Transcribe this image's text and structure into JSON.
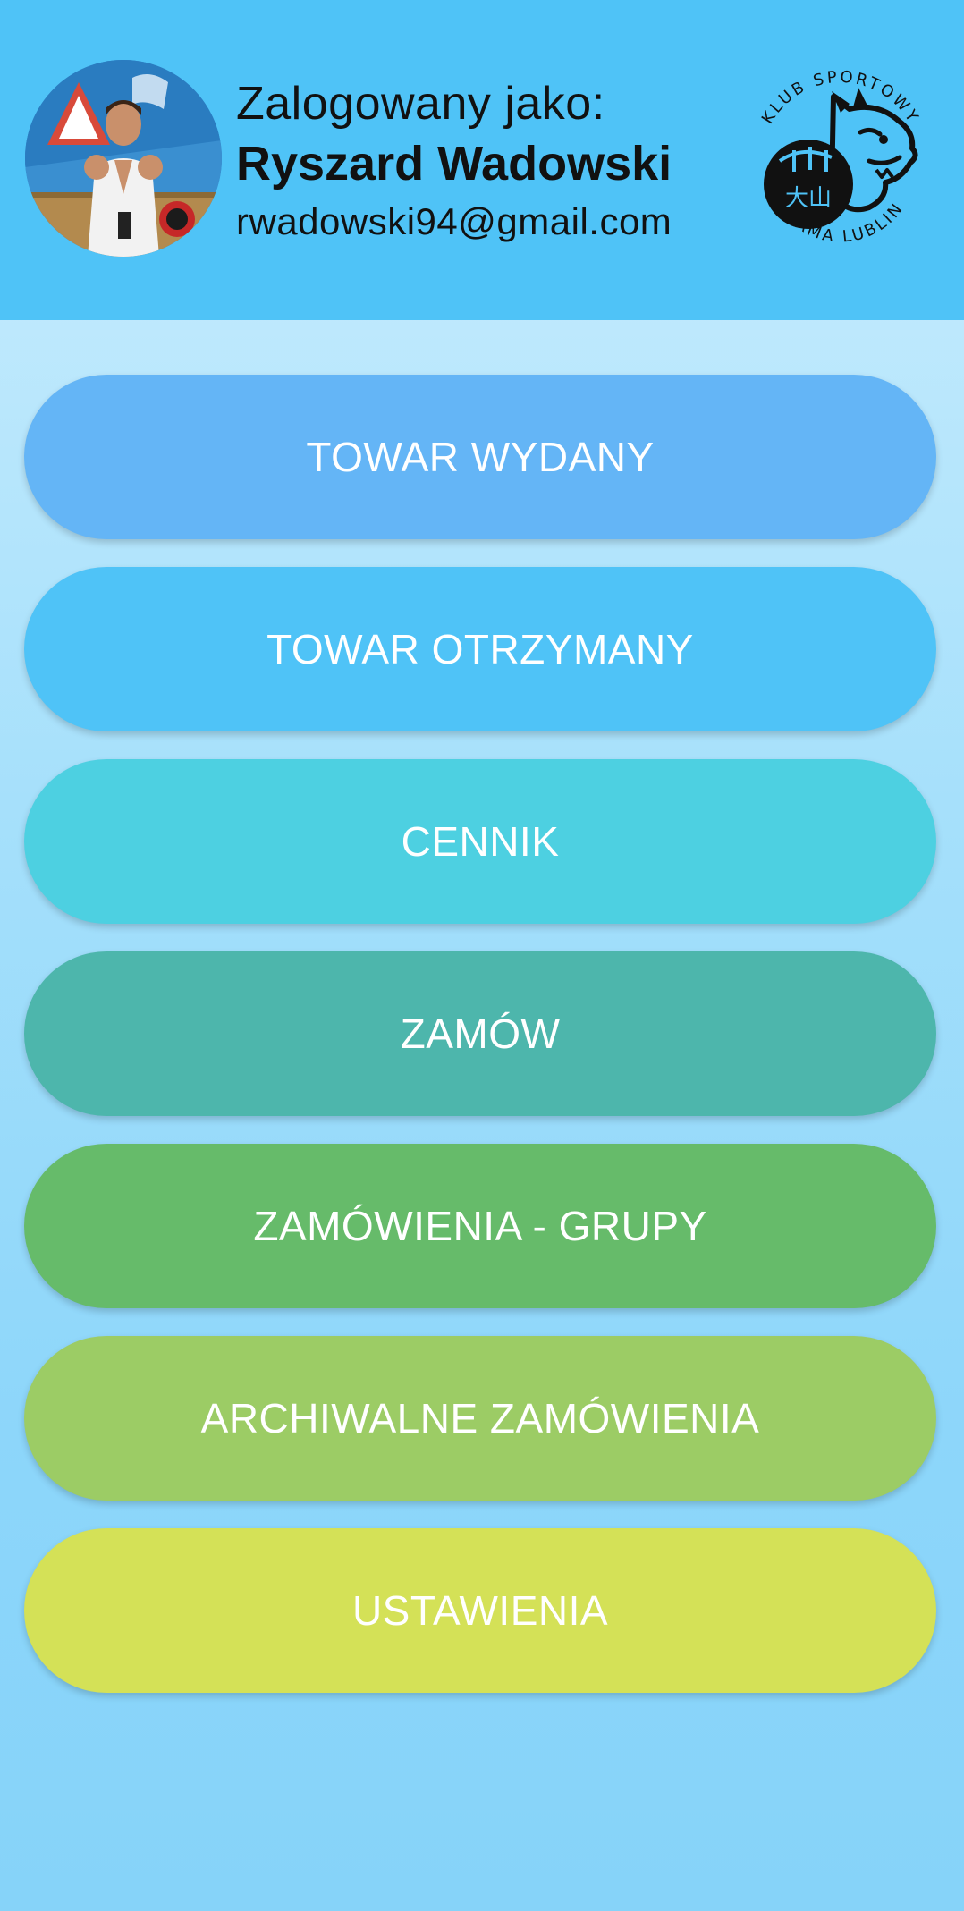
{
  "header": {
    "logged_as_label": "Zalogowany jako:",
    "user_name": "Ryszard Wadowski",
    "user_email": "rwadowski94@gmail.com",
    "background_color": "#4fc3f7",
    "logo": {
      "top_text": "KLUB SPORTOWY",
      "bottom_text": "OYAMA LUBLIN"
    }
  },
  "menu": {
    "items": [
      {
        "label": "TOWAR WYDANY",
        "color": "#64b5f6"
      },
      {
        "label": "TOWAR OTRZYMANY",
        "color": "#4fc3f7"
      },
      {
        "label": "CENNIK",
        "color": "#4dd0e1"
      },
      {
        "label": "ZAMÓW",
        "color": "#4db6ac"
      },
      {
        "label": "ZAMÓWIENIA - GRUPY",
        "color": "#66bb6a"
      },
      {
        "label": "ARCHIWALNE ZAMÓWIENIA",
        "color": "#9ccc65"
      },
      {
        "label": "USTAWIENIA",
        "color": "#d4e157"
      }
    ]
  }
}
